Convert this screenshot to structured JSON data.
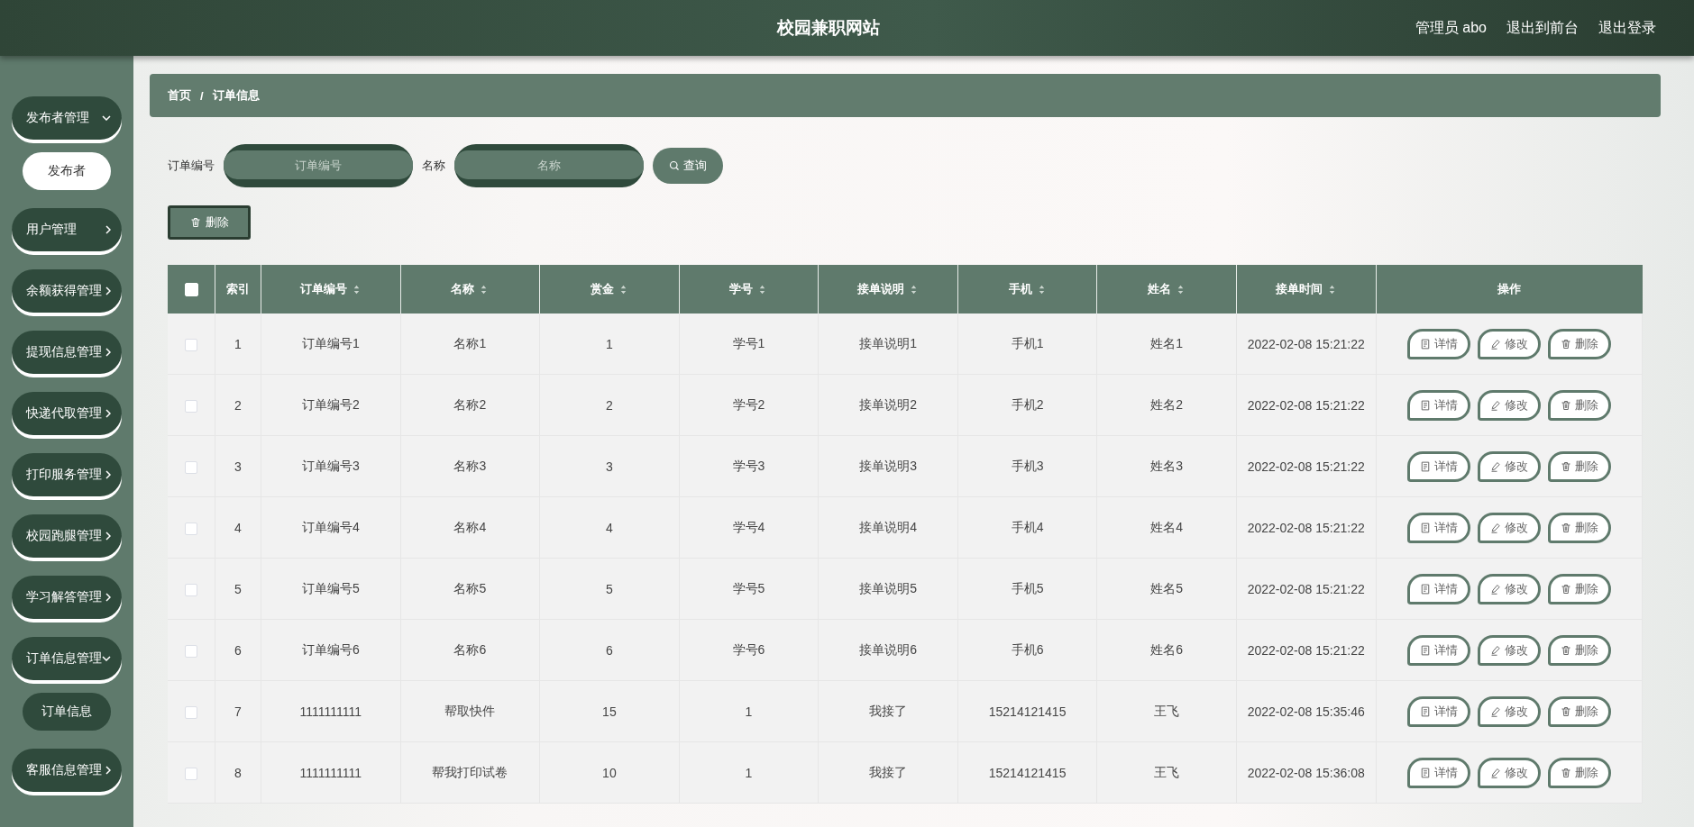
{
  "header": {
    "title": "校园兼职网站",
    "links": [
      "管理员 abo",
      "退出到前台",
      "退出登录"
    ]
  },
  "sidebar": {
    "items": [
      {
        "label": "发布者管理",
        "expanded": true,
        "children": [
          {
            "label": "发布者",
            "selected": true
          }
        ]
      },
      {
        "label": "用户管理",
        "expanded": false
      },
      {
        "label": "余额获得管理",
        "expanded": false
      },
      {
        "label": "提现信息管理",
        "expanded": false
      },
      {
        "label": "快递代取管理",
        "expanded": false
      },
      {
        "label": "打印服务管理",
        "expanded": false
      },
      {
        "label": "校园跑腿管理",
        "expanded": false
      },
      {
        "label": "学习解答管理",
        "expanded": false
      },
      {
        "label": "订单信息管理",
        "expanded": true,
        "children": [
          {
            "label": "订单信息",
            "selected": false
          }
        ]
      },
      {
        "label": "客服信息管理",
        "expanded": false
      }
    ]
  },
  "breadcrumb": {
    "items": [
      "首页",
      "订单信息"
    ],
    "separator": "/"
  },
  "search": {
    "fields": [
      {
        "label": "订单编号",
        "placeholder": "订单编号"
      },
      {
        "label": "名称",
        "placeholder": "名称"
      }
    ],
    "button": "查询"
  },
  "toolbar": {
    "delete_button": "删除"
  },
  "table": {
    "header_checked": false,
    "columns": [
      {
        "label": "索引",
        "sortable": false
      },
      {
        "label": "订单编号",
        "sortable": true
      },
      {
        "label": "名称",
        "sortable": true
      },
      {
        "label": "赏金",
        "sortable": true
      },
      {
        "label": "学号",
        "sortable": true
      },
      {
        "label": "接单说明",
        "sortable": true
      },
      {
        "label": "手机",
        "sortable": true
      },
      {
        "label": "姓名",
        "sortable": true
      },
      {
        "label": "接单时间",
        "sortable": true
      },
      {
        "label": "操作",
        "sortable": false
      }
    ],
    "rows": [
      {
        "checked": false,
        "cells": [
          "1",
          "订单编号1",
          "名称1",
          "1",
          "学号1",
          "接单说明1",
          "手机1",
          "姓名1",
          "2022-02-08 15:21:22"
        ],
        "actions": [
          "详情",
          "修改",
          "删除"
        ]
      },
      {
        "checked": false,
        "cells": [
          "2",
          "订单编号2",
          "名称2",
          "2",
          "学号2",
          "接单说明2",
          "手机2",
          "姓名2",
          "2022-02-08 15:21:22"
        ],
        "actions": [
          "详情",
          "修改",
          "删除"
        ]
      },
      {
        "checked": false,
        "cells": [
          "3",
          "订单编号3",
          "名称3",
          "3",
          "学号3",
          "接单说明3",
          "手机3",
          "姓名3",
          "2022-02-08 15:21:22"
        ],
        "actions": [
          "详情",
          "修改",
          "删除"
        ]
      },
      {
        "checked": false,
        "cells": [
          "4",
          "订单编号4",
          "名称4",
          "4",
          "学号4",
          "接单说明4",
          "手机4",
          "姓名4",
          "2022-02-08 15:21:22"
        ],
        "actions": [
          "详情",
          "修改",
          "删除"
        ]
      },
      {
        "checked": false,
        "cells": [
          "5",
          "订单编号5",
          "名称5",
          "5",
          "学号5",
          "接单说明5",
          "手机5",
          "姓名5",
          "2022-02-08 15:21:22"
        ],
        "actions": [
          "详情",
          "修改",
          "删除"
        ]
      },
      {
        "checked": false,
        "cells": [
          "6",
          "订单编号6",
          "名称6",
          "6",
          "学号6",
          "接单说明6",
          "手机6",
          "姓名6",
          "2022-02-08 15:21:22"
        ],
        "actions": [
          "详情",
          "修改",
          "删除"
        ]
      },
      {
        "checked": false,
        "cells": [
          "7",
          "1111111111",
          "帮取快件",
          "15",
          "1",
          "我接了",
          "15214121415",
          "王飞",
          "2022-02-08 15:35:46"
        ],
        "actions": [
          "详情",
          "修改",
          "删除"
        ]
      },
      {
        "checked": false,
        "cells": [
          "8",
          "1111111111",
          "帮我打印试卷",
          "10",
          "1",
          "我接了",
          "15214121415",
          "王飞",
          "2022-02-08 15:36:08"
        ],
        "actions": [
          "详情",
          "修改",
          "删除"
        ]
      }
    ]
  }
}
